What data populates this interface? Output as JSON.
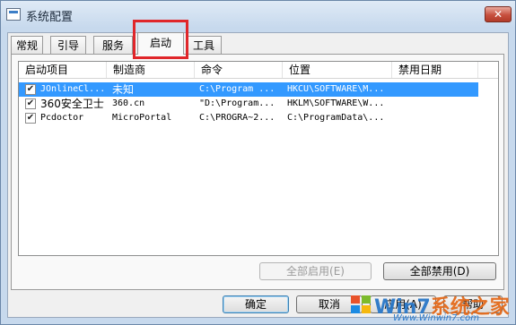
{
  "window": {
    "title": "系统配置",
    "close_label": "✕"
  },
  "tabs": [
    "常规",
    "引导",
    "服务",
    "启动",
    "工具"
  ],
  "startup": {
    "columns": [
      "启动项目",
      "制造商",
      "命令",
      "位置",
      "禁用日期"
    ],
    "rows": [
      {
        "checked": true,
        "item": "JOnlineCl...",
        "maker": "未知",
        "command": "C:\\Program ...",
        "location": "HKCU\\SOFTWARE\\M...",
        "date": "",
        "selected": true
      },
      {
        "checked": true,
        "item": "360安全卫士",
        "maker": "360.cn",
        "command": "\"D:\\Program...",
        "location": "HKLM\\SOFTWARE\\W...",
        "date": "",
        "selected": false
      },
      {
        "checked": true,
        "item": "Pcdoctor",
        "maker": "MicroPortal",
        "command": "C:\\PROGRA~2...",
        "location": "C:\\ProgramData\\...",
        "date": "",
        "selected": false
      }
    ]
  },
  "buttons": {
    "enable_all": "全部启用(E)",
    "disable_all": "全部禁用(D)",
    "ok": "确定",
    "cancel": "取消",
    "apply": "应用(A)",
    "help": "帮助"
  },
  "watermark": {
    "brand_a": "Win7",
    "brand_b": "系统之家",
    "url": "Www.Winwin7.com"
  },
  "colors": {
    "selection": "#3399ff",
    "highlight_border": "#e0262a"
  }
}
